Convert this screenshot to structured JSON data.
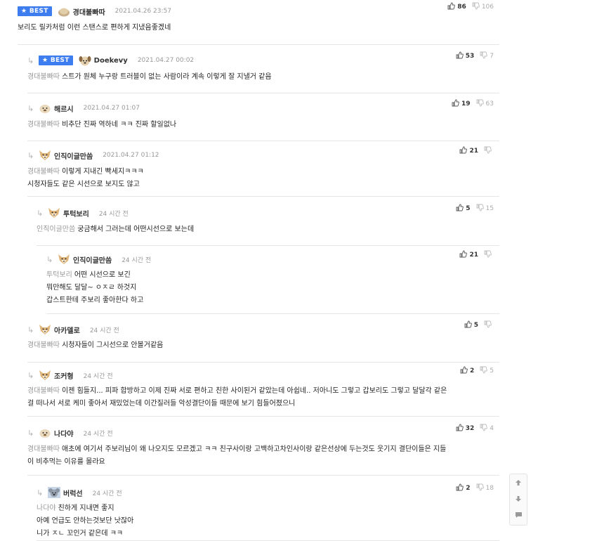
{
  "best_label": "BEST",
  "comments": [
    {
      "nick": "경대불빠따",
      "date": "2021.04.26 23:57",
      "up": "86",
      "down": "106",
      "best": true,
      "mention": "",
      "lines": [
        "보리도 릴카처럼 이런 스탠스로 편하게 지냈음좋겠네"
      ]
    },
    {
      "nick": "Doekevy",
      "date": "2021.04.27 00:02",
      "up": "53",
      "down": "7",
      "best": true,
      "mention": "경대불빠따",
      "lines": [
        "스트가 원체 누구랑 트러블이 없는 사람이라 계속 이렇게 잘 지낼거 같음"
      ]
    },
    {
      "nick": "해르시",
      "date": "2021.04.27 01:07",
      "up": "19",
      "down": "63",
      "best": false,
      "mention": "경대불빠따",
      "lines": [
        "비추단 진짜 역하네 ㅋㅋ 진짜 할일없나"
      ]
    },
    {
      "nick": "인직이글만씀",
      "date": "2021.04.27 01:12",
      "up": "21",
      "down": "",
      "best": false,
      "mention": "경대불빠따",
      "lines": [
        "이렇게 지내긴 빡세지ㅋㅋㅋ",
        "시청자들도 같은 시선으로 보지도 않고"
      ]
    },
    {
      "nick": "투턱보리",
      "date": "24 시간 전",
      "up": "5",
      "down": "15",
      "best": false,
      "mention": "인직이글만씀",
      "lines": [
        "궁금해서 그러는데 어떤시선으로 보는데"
      ]
    },
    {
      "nick": "인직이글만씀",
      "date": "24 시간 전",
      "up": "21",
      "down": "",
      "best": false,
      "mention": "투턱보리",
      "lines": [
        "어떤 시선으로 보긴",
        "뭐만해도 달달~ ㅇㅈㄹ 하것지",
        "갑스트한테 주보리 좋아한다 하고"
      ]
    },
    {
      "nick": "아카델로",
      "date": "24 시간 전",
      "up": "5",
      "down": "",
      "best": false,
      "mention": "경대불빠따",
      "lines": [
        "시청자들이 그시선으로 안볼거같음"
      ]
    },
    {
      "nick": "조커형",
      "date": "24 시간 전",
      "up": "2",
      "down": "5",
      "best": false,
      "mention": "경대불빠따",
      "lines": [
        "이젠 힘들지... 피파 합방하고 이제 진짜 서로 편하고 친한 사이된거 같았는데 아쉽네.. 저아니도 그렇고 갑보리도 그렇고 달달각 같은",
        "걸 떠나서 서로 케미 좋아서 재밌었는데 이간질러들 악성결단이들 때문에 보기 힘들어졌으니"
      ]
    },
    {
      "nick": "나다야",
      "date": "24 시간 전",
      "up": "32",
      "down": "4",
      "best": false,
      "mention": "경대불빠따",
      "lines": [
        "애초에 여기서 주보리님이 왜 나오지도 모르겠고 ㅋㅋ 친구사이랑 고백하고차인사이랑 같은선상에 두는것도 웃기지 결단이들은 지들",
        "이 비추먹는 이유를 몰라요"
      ]
    },
    {
      "nick": "버럭선",
      "date": "24 시간 전",
      "up": "2",
      "down": "18",
      "best": false,
      "mention": "나다야",
      "lines": [
        "친하게 지내면 좋지",
        "아예 언급도 안하는것보단 낫잖아",
        "니가 ㅈㄴ 꼬인거 같은데 ㅋㅋ"
      ]
    }
  ],
  "side_buttons": [
    "up-arrow-icon",
    "down-arrow-icon",
    "comment-icon"
  ],
  "colors": {
    "best_badge": "#3d7df0",
    "mention": "#9a9a9a",
    "date": "#999999"
  }
}
